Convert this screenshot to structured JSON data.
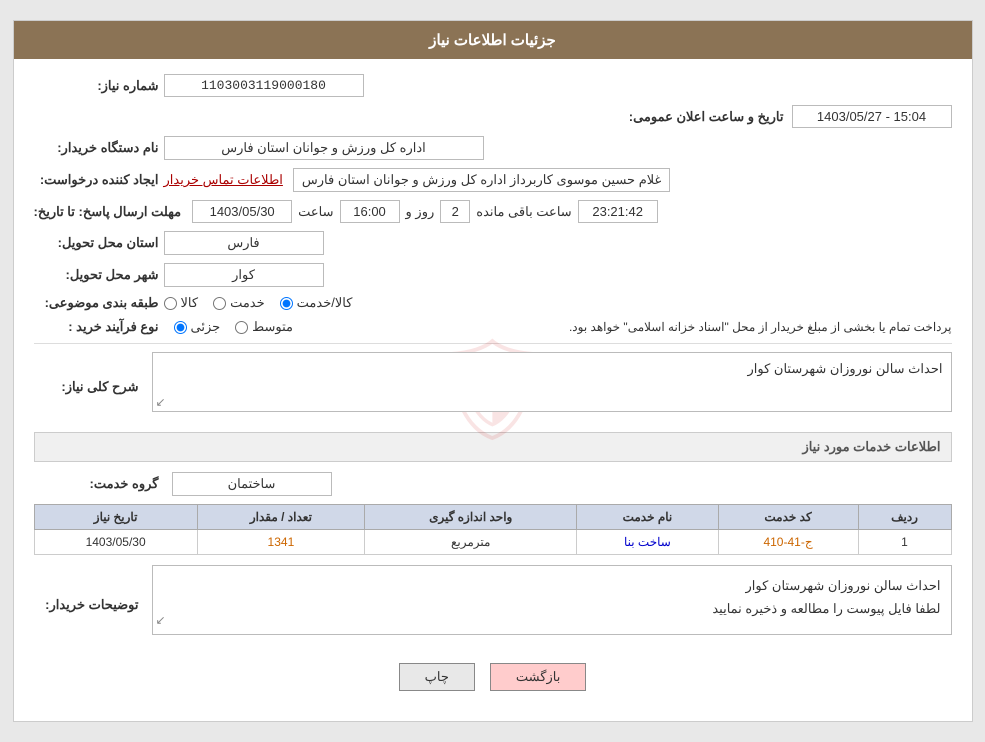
{
  "header": {
    "title": "جزئیات اطلاعات نیاز"
  },
  "fields": {
    "shomara_niaz_label": "شماره نیاز:",
    "shomara_niaz_value": "1103003119000180",
    "name_dastgah_label": "نام دستگاه خریدار:",
    "name_dastgah_value": "اداره کل ورزش و جوانان استان فارس",
    "ijad_konande_label": "ایجاد کننده درخواست:",
    "ijad_konande_value": "غلام حسین موسوی کاربرداز اداره کل ورزش و جوانان استان فارس",
    "contact_link": "اطلاعات تماس خریدار",
    "mohlat_label": "مهلت ارسال پاسخ: تا تاریخ:",
    "mohlat_date": "1403/05/30",
    "mohlat_time_label": "ساعت",
    "mohlat_time": "16:00",
    "mohlat_days_label": "روز و",
    "mohlat_days": "2",
    "mohlat_time_left": "23:21:42",
    "mohlat_remaining_label": "ساعت باقی مانده",
    "taarikh_aalan_label": "تاریخ و ساعت اعلان عمومی:",
    "taarikh_aalan_value": "1403/05/27 - 15:04",
    "ostan_label": "استان محل تحویل:",
    "ostan_value": "فارس",
    "shahr_label": "شهر محل تحویل:",
    "shahr_value": "کوار",
    "tabaqe_label": "طبقه بندی موضوعی:",
    "tabaqe_kala": "کالا",
    "tabaqe_khedmat": "خدمت",
    "tabaqe_kala_khedmat": "کالا/خدمت",
    "tabaqe_selected": "kala_khedmat",
    "nooe_farayand_label": "نوع فرآیند خرید :",
    "nooe_jozii": "جزئی",
    "nooe_mottaset": "متوسط",
    "nooe_text": "پرداخت تمام یا بخشی از مبلغ خریدار از محل \"اسناد خزانه اسلامی\" خواهد بود.",
    "sharh_label": "شرح کلی نیاز:",
    "sharh_value": "احداث سالن نوروزان شهرستان کوار",
    "khadamat_label": "اطلاعات خدمات مورد نیاز",
    "grooh_label": "گروه خدمت:",
    "grooh_value": "ساختمان",
    "table": {
      "headers": [
        "ردیف",
        "کد خدمت",
        "نام خدمت",
        "واحد اندازه گیری",
        "تعداد / مقدار",
        "تاریخ نیاز"
      ],
      "rows": [
        {
          "radif": "1",
          "kod_khedmat": "ج-41-410",
          "name_khedmat": "ساخت بنا",
          "vahed": "مترمربع",
          "tedad": "1341",
          "tarikh": "1403/05/30"
        }
      ]
    },
    "tawzihat_label": "توضیحات خریدار:",
    "tawzihat_value_line1": "احداث سالن نوروزان شهرستان کوار",
    "tawzihat_value_line2": "لطفا فایل پیوست را مطالعه و ذخیره نمایید"
  },
  "buttons": {
    "back_label": "بازگشت",
    "print_label": "چاپ"
  }
}
